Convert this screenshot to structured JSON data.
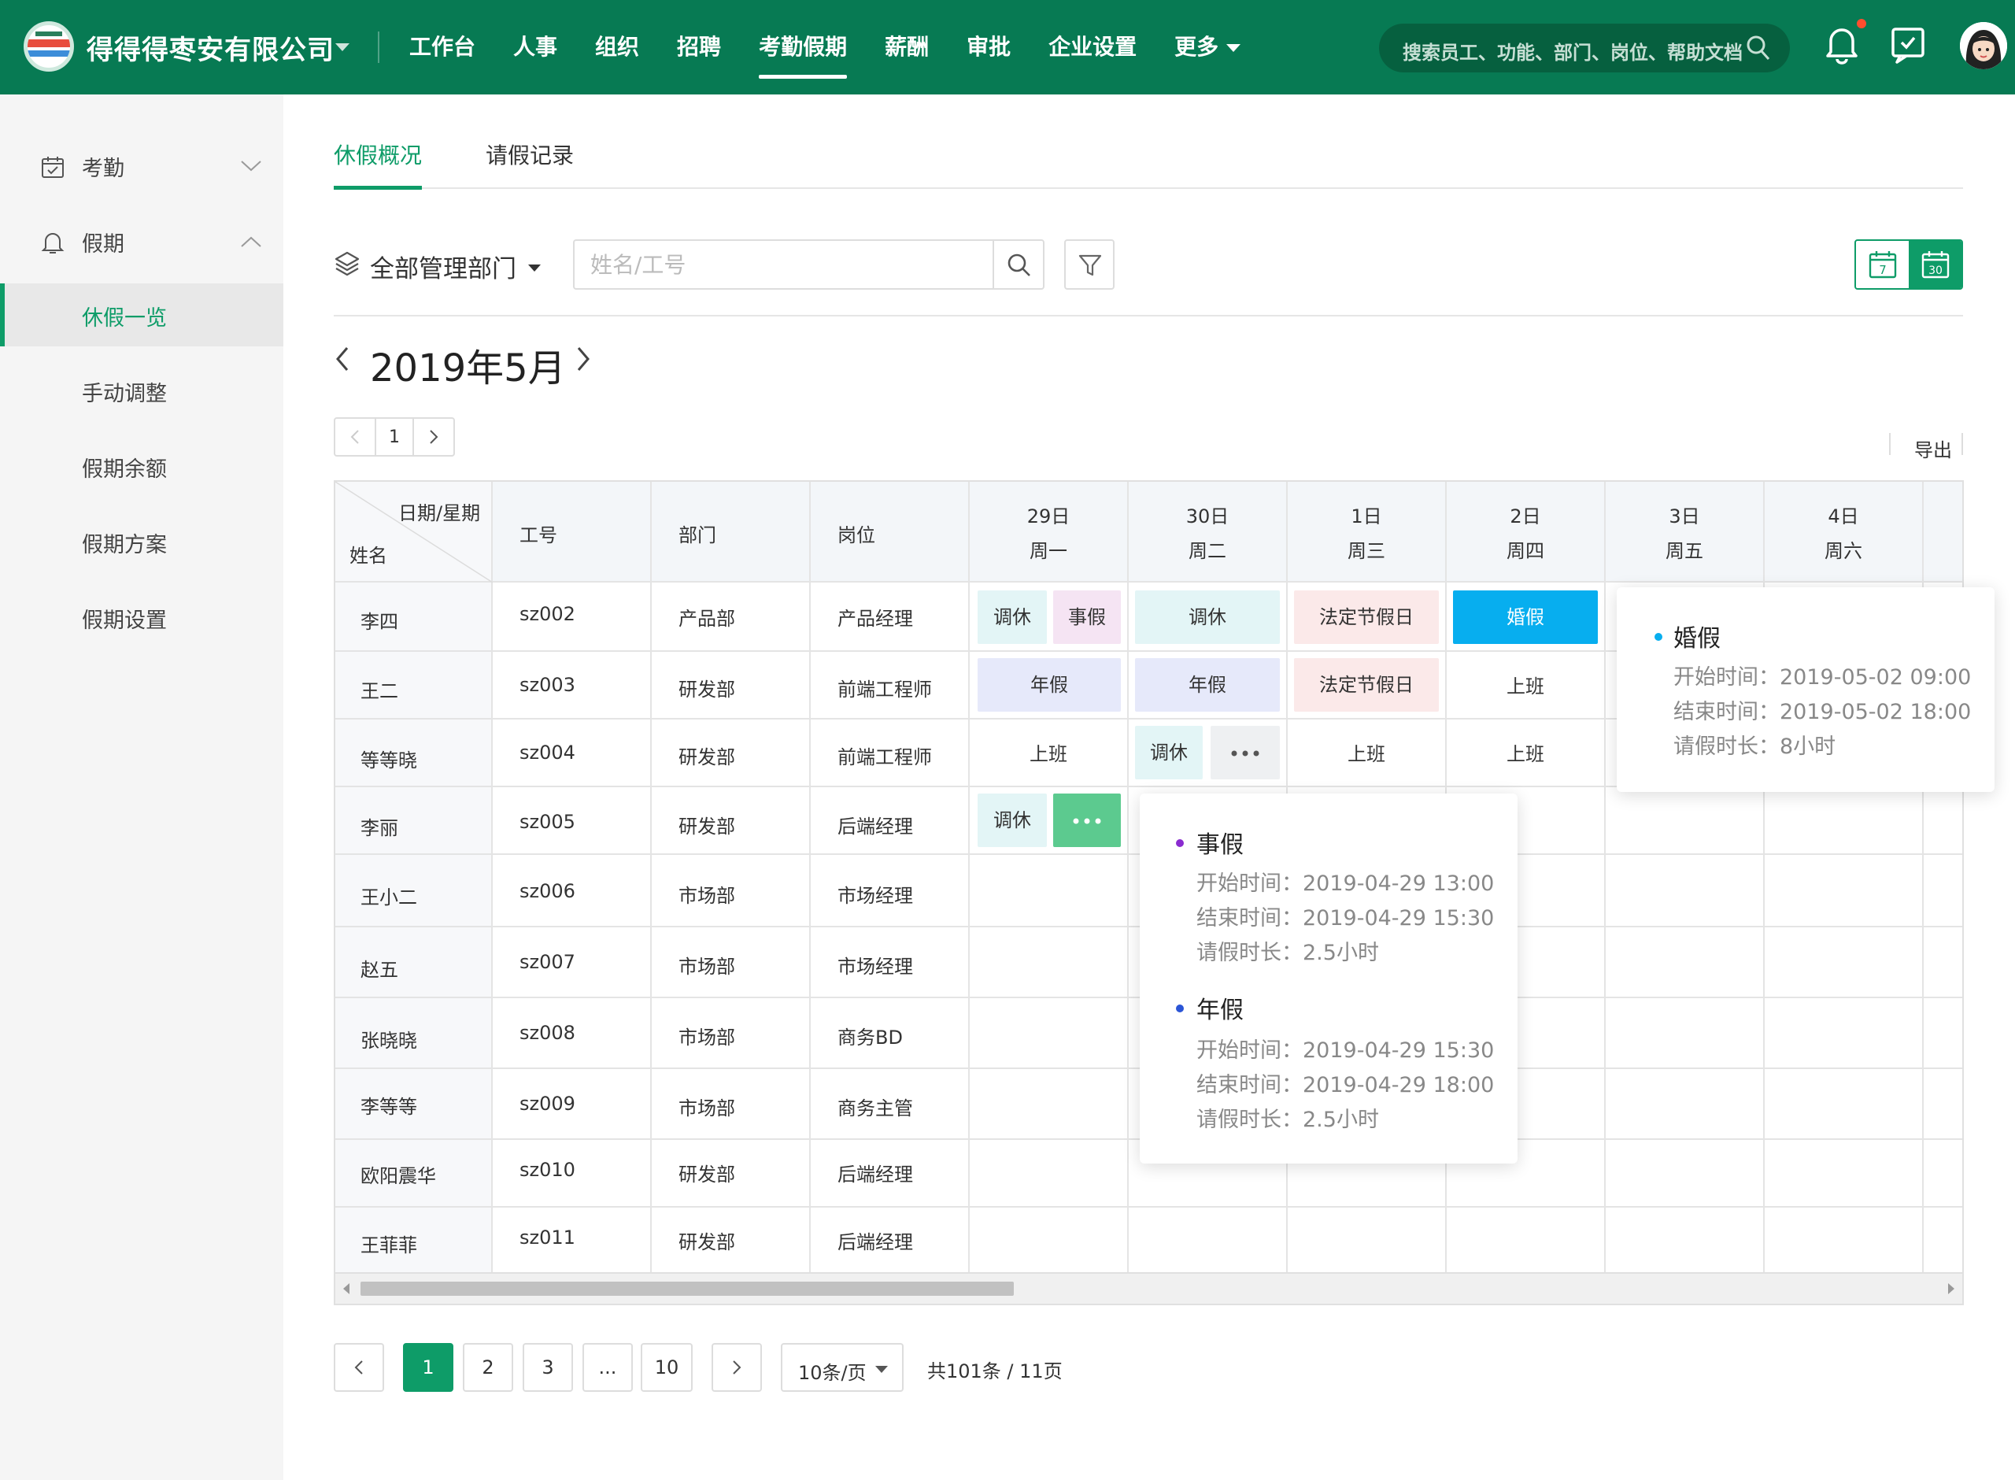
{
  "header": {
    "company": "得得得枣安有限公司",
    "nav": [
      {
        "label": "工作台",
        "active": false
      },
      {
        "label": "人事",
        "active": false
      },
      {
        "label": "组织",
        "active": false
      },
      {
        "label": "招聘",
        "active": false
      },
      {
        "label": "考勤假期",
        "active": true
      },
      {
        "label": "薪酬",
        "active": false
      },
      {
        "label": "审批",
        "active": false
      },
      {
        "label": "企业设置",
        "active": false
      }
    ],
    "more": "更多",
    "search_placeholder": "搜索员工、功能、部门、岗位、帮助文档"
  },
  "sidebar": {
    "groups": [
      {
        "label": "考勤",
        "icon": "calendar-icon",
        "expanded": false
      },
      {
        "label": "假期",
        "icon": "bell-icon",
        "expanded": true
      }
    ],
    "items": [
      {
        "label": "休假一览",
        "active": true
      },
      {
        "label": "手动调整",
        "active": false
      },
      {
        "label": "假期余额",
        "active": false
      },
      {
        "label": "假期方案",
        "active": false
      },
      {
        "label": "假期设置",
        "active": false
      }
    ]
  },
  "tabs": [
    {
      "label": "休假概况",
      "active": true
    },
    {
      "label": "请假记录",
      "active": false
    }
  ],
  "filters": {
    "department": "全部管理部门",
    "name_placeholder": "姓名/工号"
  },
  "month_title": "2019年5月",
  "mini_pager": {
    "current": "1"
  },
  "export_label": "导出",
  "table": {
    "corner_top": "日期/星期",
    "corner_bottom": "姓名",
    "columns": [
      "工号",
      "部门",
      "岗位"
    ],
    "days": [
      {
        "date": "29日",
        "weekday": "周一"
      },
      {
        "date": "30日",
        "weekday": "周二"
      },
      {
        "date": "1日",
        "weekday": "周三"
      },
      {
        "date": "2日",
        "weekday": "周四"
      },
      {
        "date": "3日",
        "weekday": "周五"
      },
      {
        "date": "4日",
        "weekday": "周六"
      }
    ],
    "rows": [
      {
        "name": "李四",
        "id": "sz002",
        "dept": "产品部",
        "position": "产品经理"
      },
      {
        "name": "王二",
        "id": "sz003",
        "dept": "研发部",
        "position": "前端工程师"
      },
      {
        "name": "等等晓",
        "id": "sz004",
        "dept": "研发部",
        "position": "前端工程师"
      },
      {
        "name": "李丽",
        "id": "sz005",
        "dept": "研发部",
        "position": "后端经理"
      },
      {
        "name": "王小二",
        "id": "sz006",
        "dept": "市场部",
        "position": "市场经理"
      },
      {
        "name": "赵五",
        "id": "sz007",
        "dept": "市场部",
        "position": "市场经理"
      },
      {
        "name": "张晓晓",
        "id": "sz008",
        "dept": "市场部",
        "position": "商务BD"
      },
      {
        "name": "李等等",
        "id": "sz009",
        "dept": "市场部",
        "position": "商务主管"
      },
      {
        "name": "欧阳震华",
        "id": "sz010",
        "dept": "研发部",
        "position": "后端经理"
      },
      {
        "name": "王菲菲",
        "id": "sz011",
        "dept": "研发部",
        "position": "后端经理"
      }
    ],
    "cells": {
      "r0_d0_a": "调休",
      "r0_d0_b": "事假",
      "r0_d1": "调休",
      "r0_d2": "法定节假日",
      "r0_d3": "婚假",
      "r1_d0": "年假",
      "r1_d1": "年假",
      "r1_d2": "法定节假日",
      "r1_d3": "上班",
      "r2_d0": "上班",
      "r2_d1_a": "调休",
      "r2_d2": "上班",
      "r2_d3": "上班",
      "r3_d0_a": "调休"
    }
  },
  "popovers": {
    "marriage": {
      "title": "婚假",
      "dot_color": "#07aeef",
      "start": "开始时间：2019-05-02 09:00",
      "end": "结束时间：2019-05-02 18:00",
      "duration": "请假时长：8小时"
    },
    "details": [
      {
        "title": "事假",
        "dot_color": "#8a2bd0",
        "start": "开始时间：2019-04-29 13:00",
        "end": "结束时间：2019-04-29 15:30",
        "duration": "请假时长：2.5小时"
      },
      {
        "title": "年假",
        "dot_color": "#2b55d6",
        "start": "开始时间：2019-04-29 15:30",
        "end": "结束时间：2019-04-29 18:00",
        "duration": "请假时长：2.5小时"
      }
    ]
  },
  "pagination": {
    "pages": [
      "1",
      "2",
      "3",
      "...",
      "10"
    ],
    "current": "1",
    "page_size": "10条/页",
    "total": "共101条 / 11页"
  },
  "colors": {
    "brand": "#077a53",
    "accent": "#0e9c68",
    "marriage_leave": "#07aeef"
  }
}
